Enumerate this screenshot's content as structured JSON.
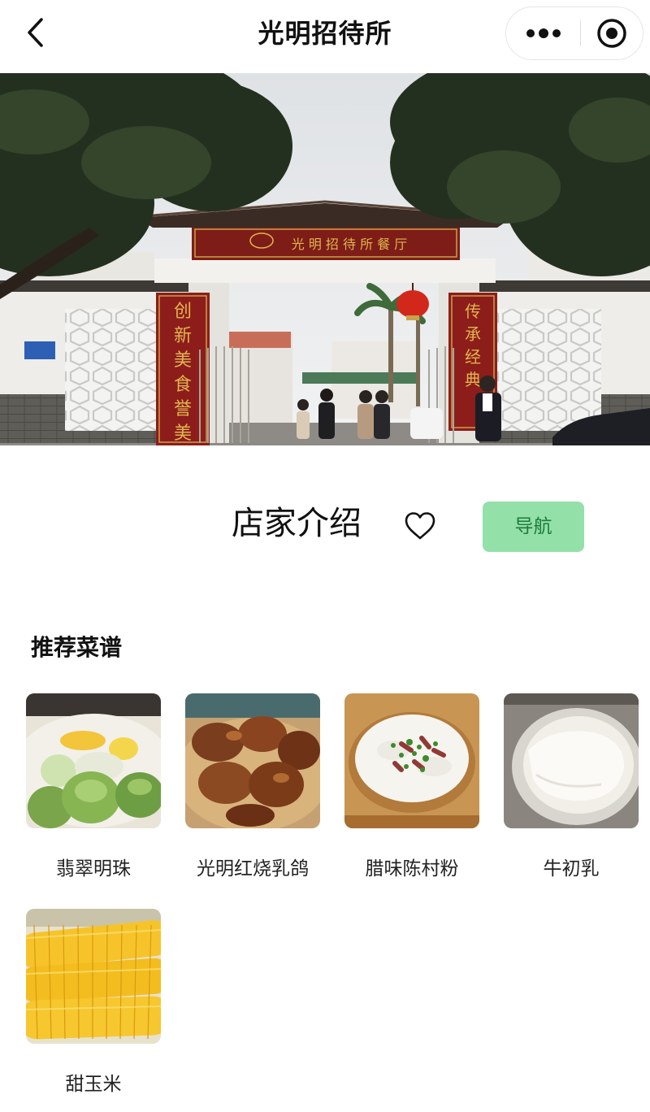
{
  "navbar": {
    "title": "光明招待所",
    "back_icon": "chevron-left-icon",
    "more_icon": "more-dots-icon",
    "close_icon": "target-circle-icon"
  },
  "hero": {
    "alt": "光明招待所 entrance archway photo",
    "couplet_left": "创新美食誉美名",
    "couplet_right": "传承经典光",
    "arch_sign": "光明招待所餐厅"
  },
  "shop": {
    "title": "店家介绍",
    "favorite_icon": "heart-outline-icon",
    "navigate_label": "导航",
    "navigate_color": "#93e0a9",
    "navigate_text_color": "#1e7a3b"
  },
  "recommend": {
    "title": "推荐菜谱",
    "dishes": [
      {
        "name": "翡翠明珠"
      },
      {
        "name": "光明红烧乳鸽"
      },
      {
        "name": "腊味陈村粉"
      },
      {
        "name": "牛初乳"
      },
      {
        "name": "甜玉米"
      }
    ]
  }
}
